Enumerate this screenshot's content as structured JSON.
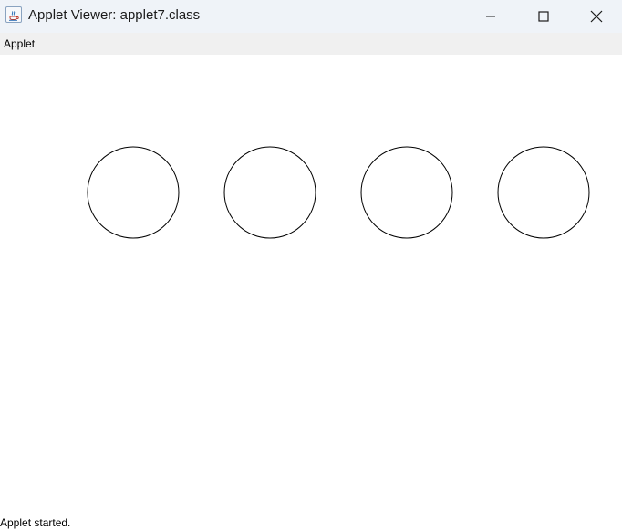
{
  "window": {
    "title": "Applet Viewer: applet7.class",
    "icon": "java-icon",
    "controls": [
      "minimize-icon",
      "maximize-icon",
      "close-icon"
    ]
  },
  "menubar": {
    "items": [
      {
        "label": "Applet"
      }
    ]
  },
  "applet": {
    "shapes": [
      {
        "type": "circle",
        "fill": "none",
        "stroke": "#000000"
      },
      {
        "type": "circle",
        "fill": "none",
        "stroke": "#000000"
      },
      {
        "type": "circle",
        "fill": "none",
        "stroke": "#000000"
      },
      {
        "type": "circle",
        "fill": "none",
        "stroke": "#000000"
      }
    ]
  },
  "status": {
    "text": "Applet started."
  }
}
